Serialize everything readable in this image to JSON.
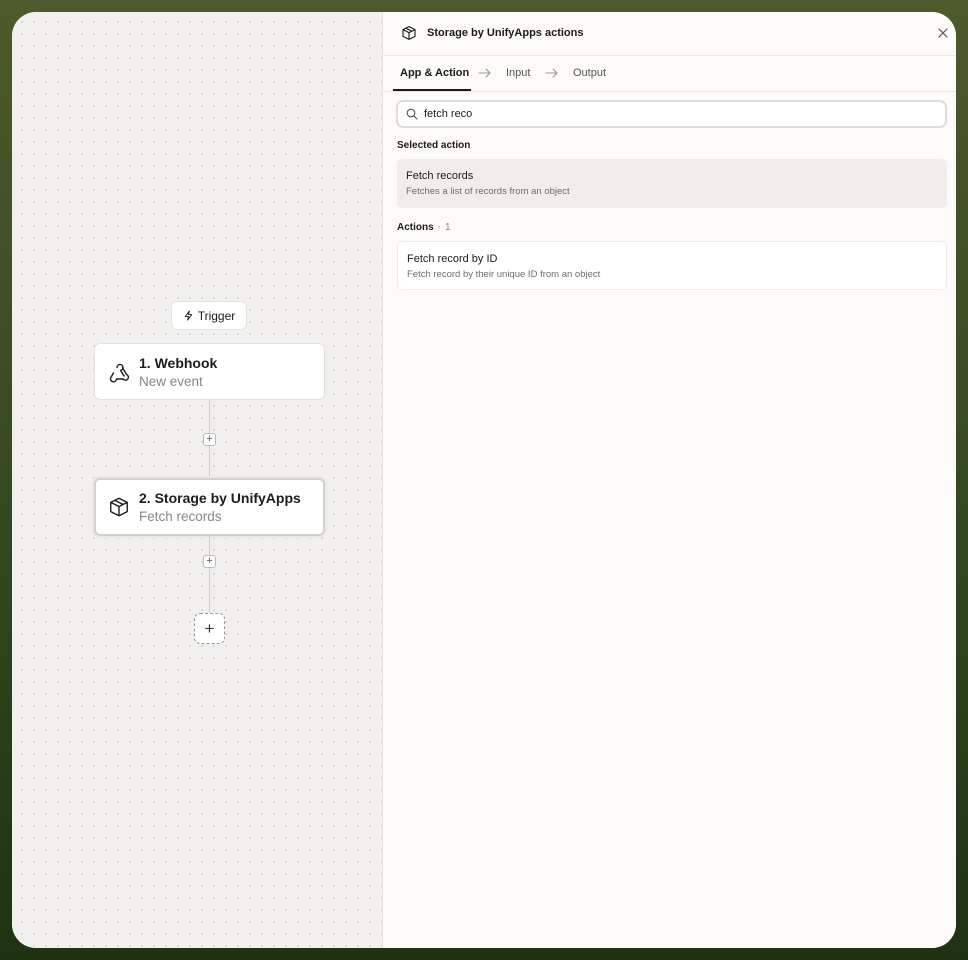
{
  "canvas": {
    "trigger_label": "Trigger",
    "nodes": [
      {
        "title": "1. Webhook",
        "subtitle": "New event",
        "icon": "webhook-icon"
      },
      {
        "title": "2. Storage by UnifyApps",
        "subtitle": "Fetch records",
        "icon": "box-icon"
      }
    ],
    "add_step_symbol": "+"
  },
  "panel": {
    "title": "Storage by UnifyApps actions",
    "tabs": [
      {
        "label": "App & Action",
        "active": true
      },
      {
        "label": "Input",
        "active": false
      },
      {
        "label": "Output",
        "active": false
      }
    ],
    "search": {
      "value": "fetch reco",
      "placeholder": "Search actions"
    },
    "selected_section": {
      "label": "Selected action",
      "item": {
        "title": "Fetch records",
        "description": "Fetches a list of records from an object"
      }
    },
    "actions_section": {
      "label": "Actions",
      "count": "1",
      "items": [
        {
          "title": "Fetch record by ID",
          "description": "Fetch record by their unique ID from an object"
        }
      ]
    }
  },
  "colors": {
    "frame": "#3f4f24",
    "canvas_bg": "#f1f0ee",
    "panel_bg": "#fcfbf9",
    "text": "#1c1c1a"
  }
}
